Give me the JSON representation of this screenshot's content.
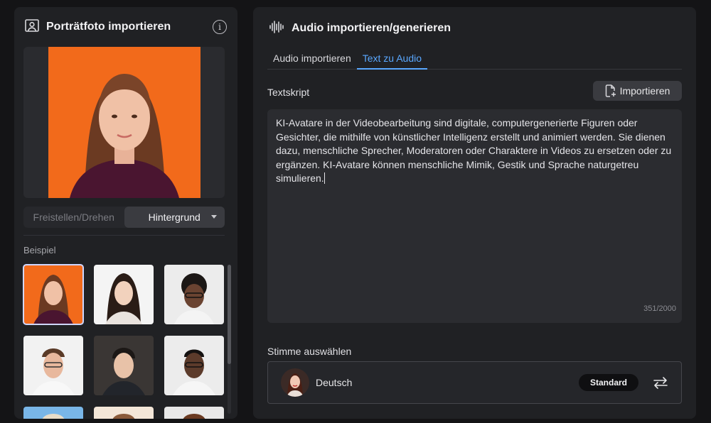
{
  "left": {
    "title": "Porträtfoto importieren",
    "info_icon": "info-icon",
    "segment": {
      "options": [
        "Freistellen/Drehen",
        "Hintergrund"
      ],
      "active": "Hintergrund"
    },
    "examples_label": "Beispiel"
  },
  "right": {
    "title": "Audio importieren/generieren",
    "tabs": [
      "Audio importieren",
      "Text zu Audio"
    ],
    "active_tab": "Text zu Audio",
    "script_label": "Textskript",
    "import_button": "Importieren",
    "script_text": "KI-Avatare in der Videobearbeitung sind digitale, computergenerierte Figuren oder Gesichter, die mithilfe von künstlicher Intelligenz erstellt und animiert werden. Sie dienen dazu, menschliche Sprecher, Moderatoren oder Charaktere in Videos zu ersetzen oder zu ergänzen.  KI-Avatare können menschliche Mimik, Gestik und Sprache naturgetreu simulieren.",
    "char_count": "351/2000",
    "voice_label": "Stimme auswählen",
    "voice": {
      "name": "Deutsch",
      "badge": "Standard"
    }
  },
  "colors": {
    "accent": "#5aa8ff",
    "portrait_bg": "#f26a1b"
  }
}
